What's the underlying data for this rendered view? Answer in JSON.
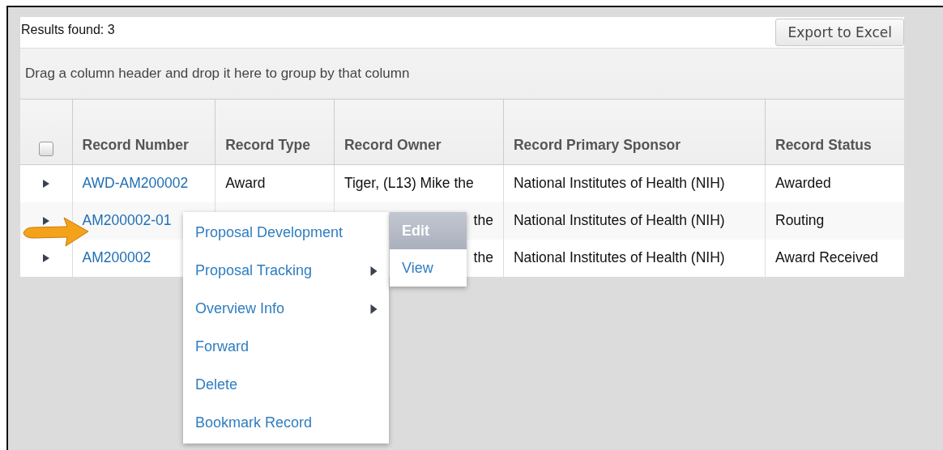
{
  "results_label": "Results found: 3",
  "export_button": "Export to Excel",
  "group_hint": "Drag a column header and drop it here to group by that column",
  "select_all": {
    "checked": false
  },
  "columns": [
    "Record Number",
    "Record Type",
    "Record Owner",
    "Record Primary Sponsor",
    "Record Status"
  ],
  "rows": [
    {
      "number": "AWD-AM200002",
      "type": "Award",
      "owner": "Tiger, (L13) Mike the",
      "sponsor": "National Institutes of Health (NIH)",
      "status": "Awarded",
      "covered": false
    },
    {
      "number": "AM200002-01",
      "owner": "the",
      "sponsor": "National Institutes of Health (NIH)",
      "status": "Routing",
      "covered": true
    },
    {
      "number": "AM200002",
      "owner": "the",
      "sponsor": "National Institutes of Health (NIH)",
      "status": "Award Received",
      "covered": true
    }
  ],
  "context_menu": {
    "items": [
      {
        "label": "Proposal Development",
        "submenu": false
      },
      {
        "label": "Proposal Tracking",
        "submenu": true
      },
      {
        "label": "Overview Info",
        "submenu": true
      },
      {
        "label": "Forward",
        "submenu": false
      },
      {
        "label": "Delete",
        "submenu": false
      },
      {
        "label": "Bookmark Record",
        "submenu": false
      }
    ],
    "submenu": [
      {
        "label": "Edit",
        "selected": true
      },
      {
        "label": "View",
        "selected": false
      }
    ]
  }
}
